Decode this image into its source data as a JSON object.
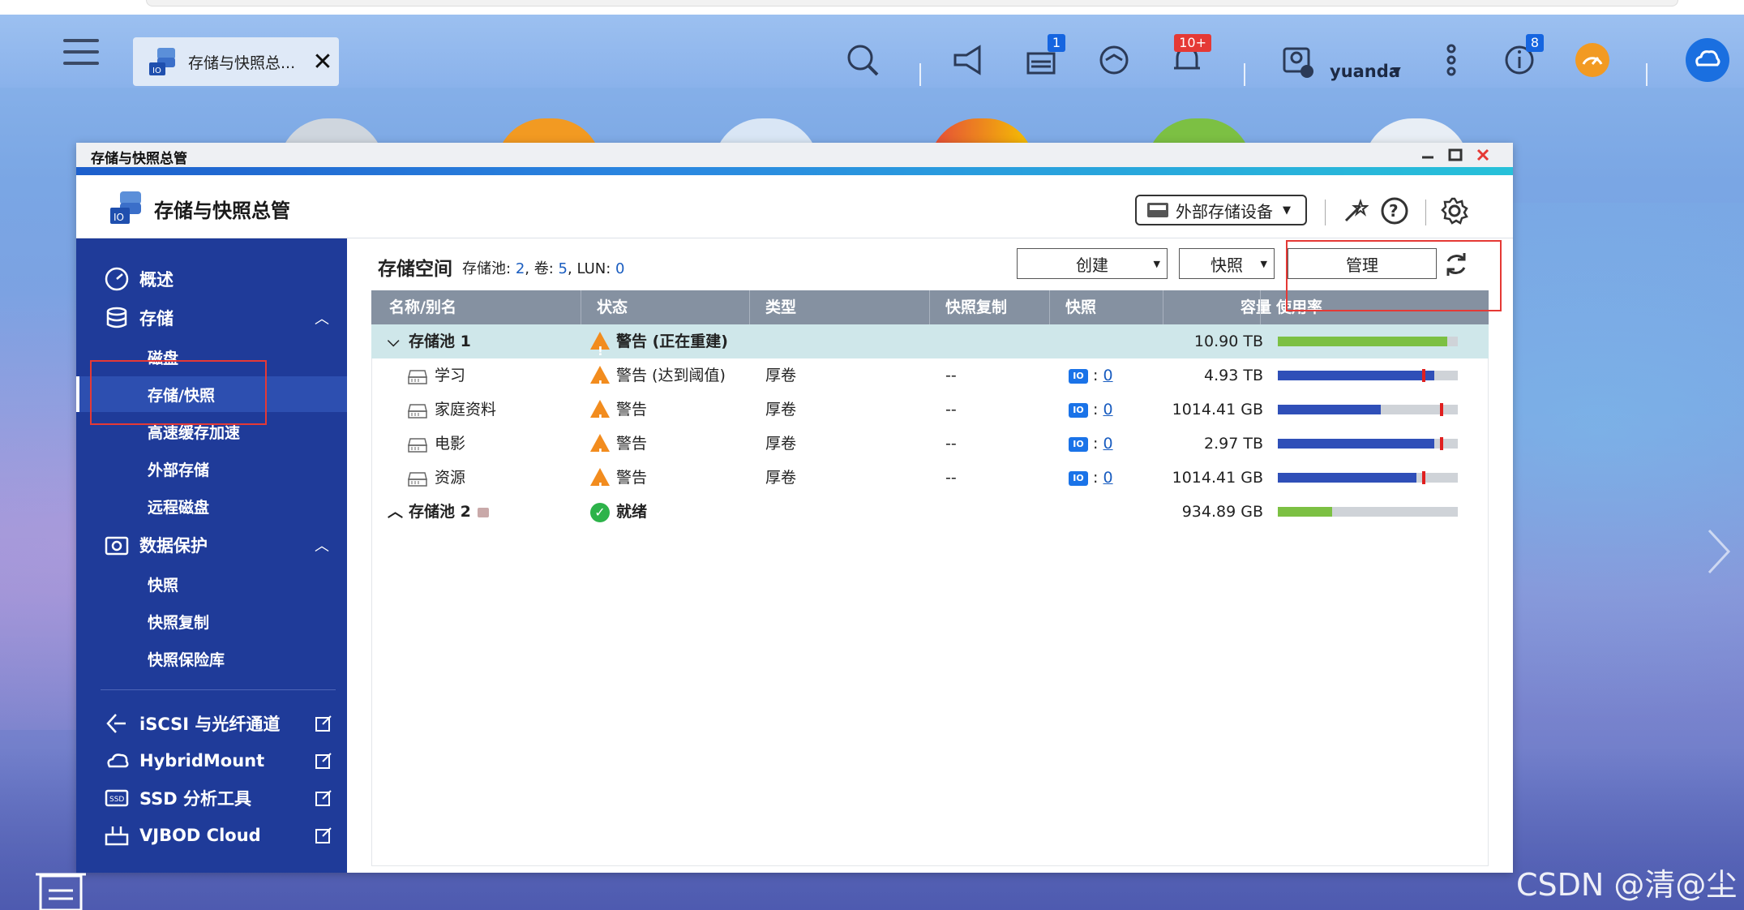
{
  "topbar": {
    "tab_title": "存储与快照总...",
    "badges": {
      "tasks": "1",
      "notifications": "10+",
      "info": "8"
    },
    "user_name": "yuanda"
  },
  "window": {
    "title": "存储与快照总管",
    "app_title": "存储与快照总管",
    "external_storage_label": "外部存储设备"
  },
  "sidebar": {
    "overview": "概述",
    "storage": "存储",
    "storage_items": [
      "磁盘",
      "存储/快照",
      "高速缓存加速",
      "外部存储",
      "远程磁盘"
    ],
    "data_protection": "数据保护",
    "protection_items": [
      "快照",
      "快照复制",
      "快照保险库"
    ],
    "external_links": [
      "iSCSI 与光纤通道",
      "HybridMount",
      "SSD 分析工具",
      "VJBOD Cloud"
    ]
  },
  "content": {
    "title": "存储空间",
    "stats_pool_label": "存储池:",
    "stats_pool": "2",
    "stats_vol_label": "卷:",
    "stats_vol": "5",
    "stats_lun_label": "LUN:",
    "stats_lun": "0",
    "create_label": "创建",
    "snapshot_label": "快照",
    "manage_label": "管理",
    "columns": [
      "名称/别名",
      "状态",
      "类型",
      "快照复制",
      "快照",
      "容量",
      "使用率"
    ],
    "rows": [
      {
        "name": "存储池 1",
        "status": "警告 (正在重建)",
        "type": "",
        "replication": "",
        "snapshots": "",
        "capacity": "10.90 TB",
        "usage": 0.94,
        "kind": "pool",
        "color": "#7cc043"
      },
      {
        "name": "学习",
        "status": "警告 (达到阈值)",
        "type": "厚卷",
        "replication": "--",
        "snapshots": "0",
        "capacity": "4.93 TB",
        "usage": 0.87,
        "threshold": 0.8,
        "kind": "volume",
        "color": "#2f4fb8"
      },
      {
        "name": "家庭资料",
        "status": "警告",
        "type": "厚卷",
        "replication": "--",
        "snapshots": "0",
        "capacity": "1014.41 GB",
        "usage": 0.57,
        "threshold": 0.9,
        "kind": "volume",
        "color": "#2f4fb8"
      },
      {
        "name": "电影",
        "status": "警告",
        "type": "厚卷",
        "replication": "--",
        "snapshots": "0",
        "capacity": "2.97 TB",
        "usage": 0.87,
        "threshold": 0.9,
        "kind": "volume",
        "color": "#2f4fb8"
      },
      {
        "name": "资源",
        "status": "警告",
        "type": "厚卷",
        "replication": "--",
        "snapshots": "0",
        "capacity": "1014.41 GB",
        "usage": 0.77,
        "threshold": 0.8,
        "kind": "volume",
        "color": "#2f4fb8"
      },
      {
        "name": "存储池 2",
        "status": "就绪",
        "type": "",
        "replication": "",
        "snapshots": "",
        "capacity": "934.89 GB",
        "usage": 0.3,
        "kind": "pool",
        "color": "#7cc043"
      }
    ]
  },
  "watermark": "CSDN @清@尘"
}
